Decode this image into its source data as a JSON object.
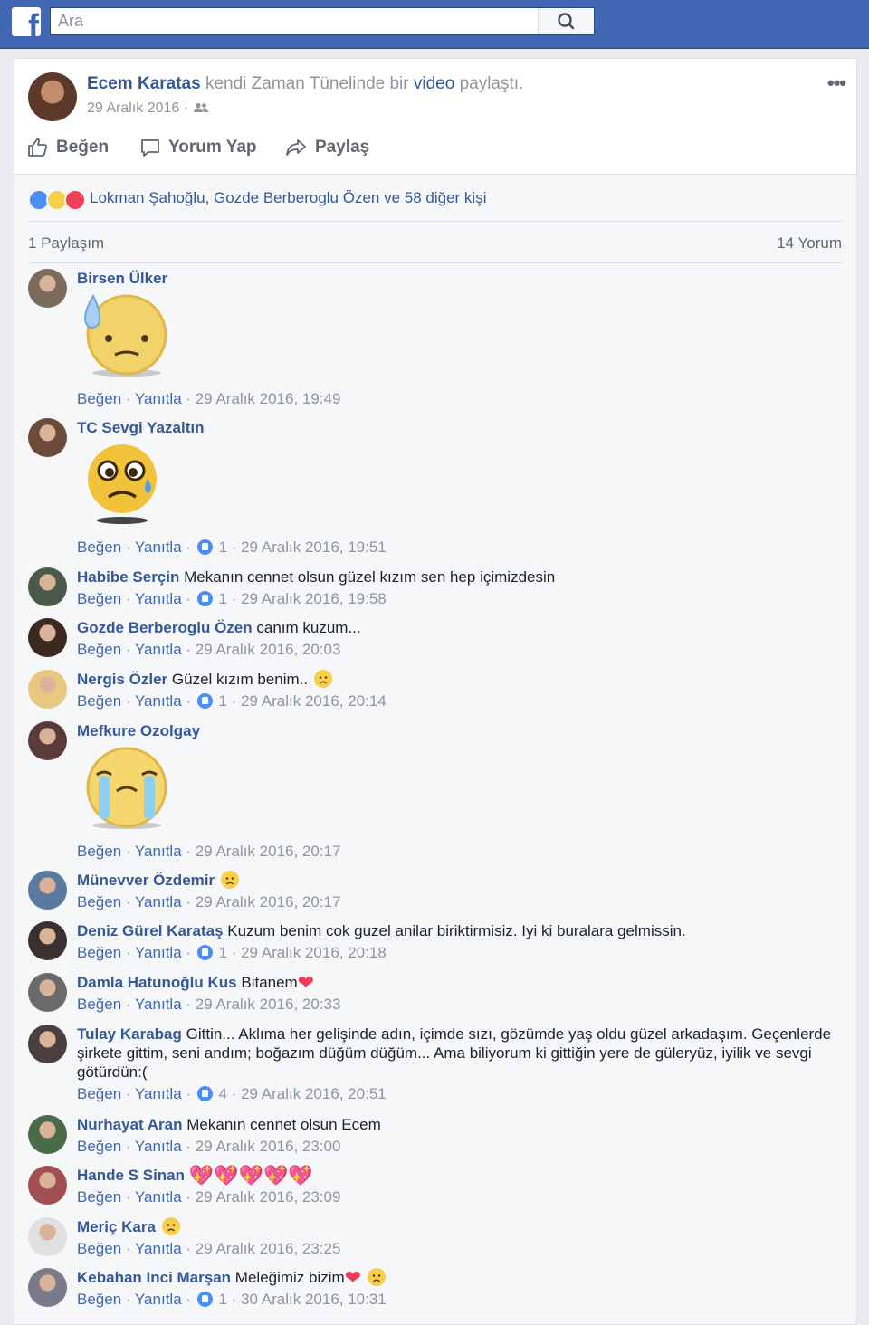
{
  "topbar": {
    "search_placeholder": "Ara",
    "logo_letter": "f"
  },
  "post": {
    "author": "Ecem Karatas",
    "action_prefix": " kendi Zaman Tünelinde bir ",
    "action_link": "video",
    "action_suffix": " paylaştı.",
    "date": "29 Aralık 2016 · ",
    "audience_icon": "friends-icon"
  },
  "actions": {
    "like": "Beğen",
    "comment": "Yorum Yap",
    "share": "Paylaş"
  },
  "reactions": {
    "text": "Lokman Şahoğlu, Gozde Berberoglu Özen ve 58 diğer kişi",
    "icons": [
      "like-icon",
      "sad-icon",
      "love-icon"
    ]
  },
  "stats": {
    "shares": "1 Paylaşım",
    "comments": "14 Yorum"
  },
  "footer_labels": {
    "like": "Beğen",
    "reply": "Yanıtla"
  },
  "colors": {
    "brand": "#4267b2",
    "link": "#365899",
    "meta": "#90949c",
    "background": "#e9ebee"
  },
  "comments": [
    {
      "name": "Birsen Ülker",
      "text": "",
      "sticker": "sweat-face-sticker",
      "likes": "",
      "time": "29 Aralık 2016, 19:49"
    },
    {
      "name": "TC Sevgi Yazaltın",
      "text": "",
      "sticker": "worried-tear-sticker",
      "likes": "1",
      "time": "29 Aralık 2016, 19:51"
    },
    {
      "name": "Habibe Serçin",
      "text": "Mekanın cennet olsun güzel kızım sen hep içimizdesin",
      "likes": "1",
      "time": "29 Aralık 2016, 19:58"
    },
    {
      "name": "Gozde Berberoglu Özen",
      "text": "canım kuzum...",
      "likes": "",
      "time": "29 Aralık 2016, 20:03"
    },
    {
      "name": "Nergis Özler",
      "text": "Güzel kızım benim..",
      "emoji": "sad",
      "likes": "1",
      "time": "29 Aralık 2016, 20:14"
    },
    {
      "name": "Mefkure Ozolgay",
      "text": "",
      "sticker": "crying-face-sticker",
      "likes": "",
      "time": "29 Aralık 2016, 20:17"
    },
    {
      "name": "Münevver Özdemir",
      "text": "",
      "emoji": "disappointed",
      "likes": "",
      "time": "29 Aralık 2016, 20:17"
    },
    {
      "name": "Deniz Gürel Karataş",
      "text": "Kuzum benim cok guzel anilar biriktirmisiz. Iyi ki buralara gelmissin.",
      "likes": "1",
      "time": "29 Aralık 2016, 20:18"
    },
    {
      "name": "Damla Hatunoğlu Kus",
      "text": "Bitanem",
      "hearts": "❤",
      "likes": "",
      "time": "29 Aralık 2016, 20:33"
    },
    {
      "name": "Tulay Karabag",
      "text": "Gittin... Aklıma her gelişinde adın, içimde sızı, gözümde yaş oldu güzel arkadaşım. Geçenlerde şirkete gittim, seni andım; boğazım düğüm düğüm... Ama biliyorum ki gittiğin yere de güleryüz, iyilik ve sevgi götürdün:(",
      "likes": "4",
      "time": "29 Aralık 2016, 20:51"
    },
    {
      "name": "Nurhayat Aran",
      "text": "Mekanın cennet olsun Ecem",
      "likes": "",
      "time": "29 Aralık 2016, 23:00"
    },
    {
      "name": "Hande S Sinan",
      "text": "",
      "hearts": "💖💖💖💖💖",
      "likes": "",
      "time": "29 Aralık 2016, 23:09"
    },
    {
      "name": "Meriç Kara",
      "text": "",
      "emoji": "sad",
      "likes": "",
      "time": "29 Aralık 2016, 23:25"
    },
    {
      "name": "Kebahan Inci Marşan",
      "text": "Meleğimiz bizim",
      "hearts": "❤",
      "emoji": "sad",
      "likes": "1",
      "time": "30 Aralık 2016, 10:31"
    }
  ]
}
